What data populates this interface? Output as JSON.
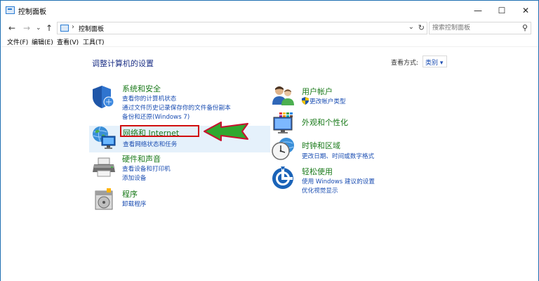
{
  "window": {
    "title": "控制面板",
    "minimize": "—",
    "maximize": "☐",
    "close": "✕"
  },
  "address": {
    "back": "←",
    "forward": "→",
    "recent": "⌄",
    "up": "↑",
    "separator": "›",
    "path": "控制面板",
    "dropdown": "⌄",
    "refresh": "↻",
    "search_placeholder": "搜索控制面板",
    "search_icon": "⚲"
  },
  "menu": [
    "文件(F)",
    "编辑(E)",
    "查看(V)",
    "工具(T)"
  ],
  "main": {
    "heading": "调整计算机的设置",
    "view_by_label": "查看方式:",
    "view_by_value": "类别 ▾"
  },
  "categories": {
    "system": {
      "title": "系统和安全",
      "links": [
        "查看你的计算机状态",
        "通过文件历史记录保存你的文件备份副本",
        "备份和还原(Windows 7)"
      ],
      "icon": "shield-icon"
    },
    "network": {
      "title": "网络和 Internet",
      "links": [
        "查看网络状态和任务"
      ],
      "icon": "network-globe-icon"
    },
    "hardware": {
      "title": "硬件和声音",
      "links": [
        "查看设备和打印机",
        "添加设备"
      ],
      "icon": "printer-icon"
    },
    "programs": {
      "title": "程序",
      "links": [
        "卸载程序"
      ],
      "icon": "programs-disk-icon"
    },
    "accounts": {
      "title": "用户帐户",
      "links": [
        "更改帐户类型"
      ],
      "icon": "users-icon"
    },
    "appearance": {
      "title": "外观和个性化",
      "links": [],
      "icon": "monitor-palette-icon"
    },
    "clock": {
      "title": "时钟和区域",
      "links": [
        "更改日期、时间或数字格式"
      ],
      "icon": "clock-globe-icon"
    },
    "ease": {
      "title": "轻松使用",
      "links": [
        "使用 Windows 建议的设置",
        "优化视觉显示"
      ],
      "icon": "ease-of-access-icon"
    }
  },
  "colors": {
    "category_title": "#1a7a1a",
    "link": "#1a4db2",
    "heading": "#1e3287",
    "annotation_red": "#d10f0f",
    "arrow_green": "#2fa82f"
  }
}
